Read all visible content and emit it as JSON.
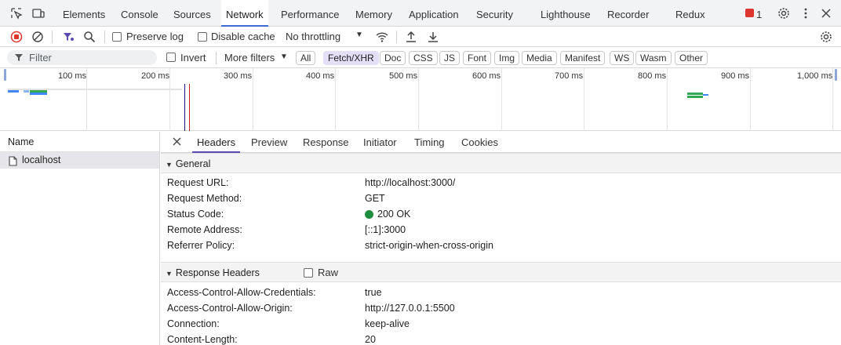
{
  "top_tabs": [
    "Elements",
    "Console",
    "Sources",
    "Network",
    "Performance",
    "Memory",
    "Application",
    "Security",
    "Lighthouse",
    "Recorder",
    "Redux"
  ],
  "active_top_tab": "Network",
  "error_count": "1",
  "toolbar": {
    "preserve_log": "Preserve log",
    "disable_cache": "Disable cache",
    "throttling": "No throttling"
  },
  "filter": {
    "placeholder": "Filter",
    "invert": "Invert",
    "more_filters": "More filters",
    "chips": [
      "All",
      "Fetch/XHR",
      "Doc",
      "CSS",
      "JS",
      "Font",
      "Img",
      "Media",
      "Manifest",
      "WS",
      "Wasm",
      "Other"
    ],
    "active_chip": "Fetch/XHR"
  },
  "timeline": {
    "ticks": [
      "100 ms",
      "200 ms",
      "300 ms",
      "400 ms",
      "500 ms",
      "600 ms",
      "700 ms",
      "800 ms",
      "900 ms",
      "1,000 ms"
    ]
  },
  "name_panel": {
    "header": "Name",
    "requests": [
      "localhost"
    ]
  },
  "detail_tabs": [
    "Headers",
    "Preview",
    "Response",
    "Initiator",
    "Timing",
    "Cookies"
  ],
  "active_detail_tab": "Headers",
  "general": {
    "title": "General",
    "rows": [
      {
        "key": "Request URL:",
        "value": "http://localhost:3000/"
      },
      {
        "key": "Request Method:",
        "value": "GET"
      },
      {
        "key": "Status Code:",
        "value": "200 OK"
      },
      {
        "key": "Remote Address:",
        "value": "[::1]:3000"
      },
      {
        "key": "Referrer Policy:",
        "value": "strict-origin-when-cross-origin"
      }
    ],
    "status_color": "#1e8e3e"
  },
  "response_headers": {
    "title": "Response Headers",
    "raw_label": "Raw",
    "rows": [
      {
        "key": "Access-Control-Allow-Credentials:",
        "value": "true"
      },
      {
        "key": "Access-Control-Allow-Origin:",
        "value": "http://127.0.0.1:5500"
      },
      {
        "key": "Connection:",
        "value": "keep-alive"
      },
      {
        "key": "Content-Length:",
        "value": "20"
      }
    ]
  },
  "colors": {
    "accent": "#3c6dd1",
    "record_red": "#dc362e",
    "chip_active_bg": "#e5def7"
  }
}
